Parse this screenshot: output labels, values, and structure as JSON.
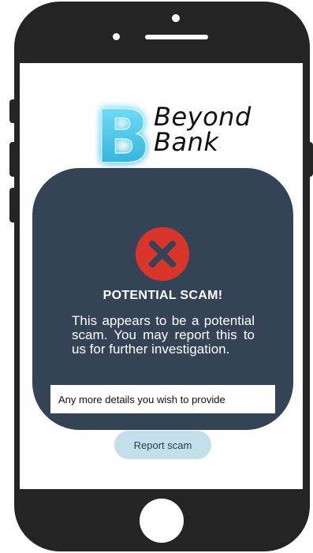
{
  "logo": {
    "letter": "B",
    "line1": "Beyond",
    "line2": "Bank"
  },
  "dialog": {
    "icon": "error-x-icon",
    "title": "POTENTIAL SCAM!",
    "message": "This appears to be a potential scam. You may report this to us for further investigation.",
    "details_placeholder": "Any more details you wish to provide"
  },
  "report_button": {
    "label": "Report scam"
  },
  "colors": {
    "phone_body": "#242424",
    "dialog_bg": "#354357",
    "error_red": "#d9352b",
    "logo_glow": "#38c9f0",
    "button_bg": "#c3e0ea"
  }
}
